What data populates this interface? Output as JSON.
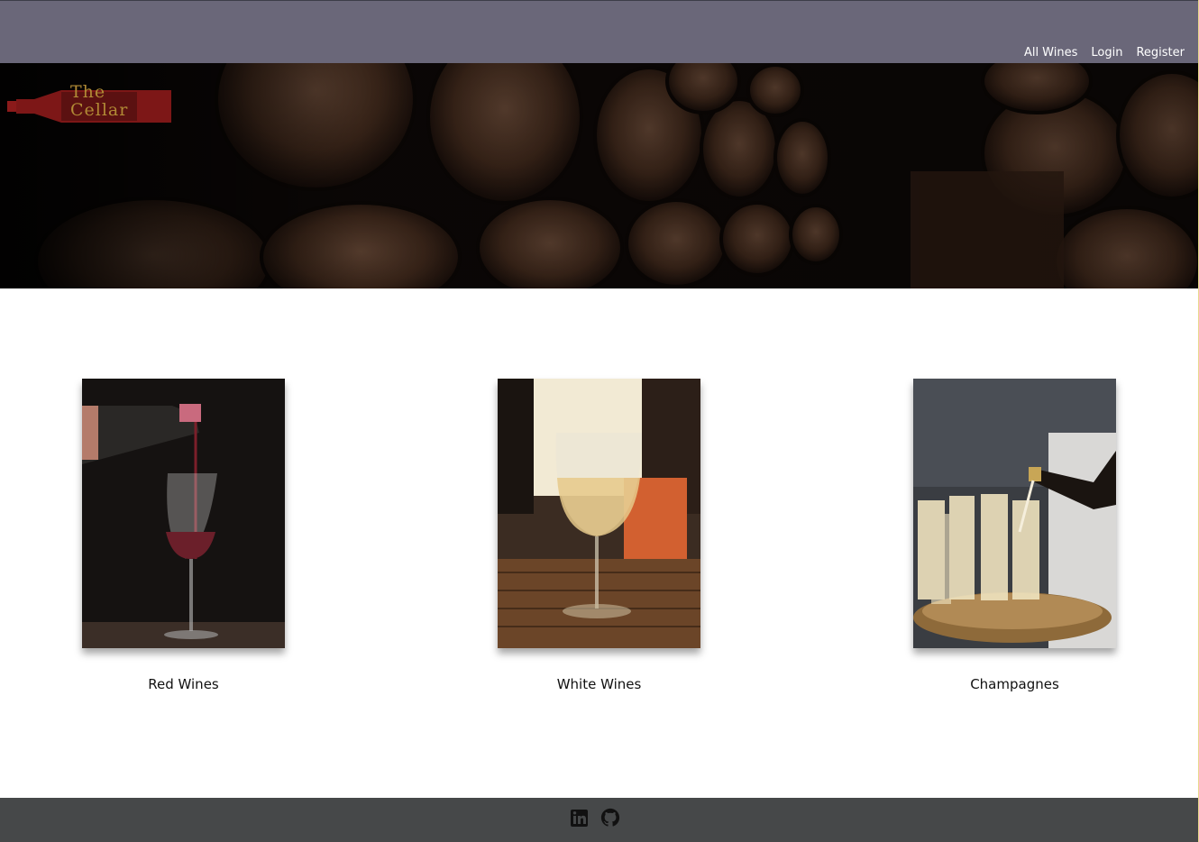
{
  "nav": {
    "links": [
      "All Wines",
      "Login",
      "Register"
    ]
  },
  "logo": {
    "line1": "The",
    "line2": "Cellar"
  },
  "categories": [
    {
      "label": "Red Wines"
    },
    {
      "label": "White Wines"
    },
    {
      "label": "Champagnes"
    }
  ],
  "footer": {
    "icons": [
      "linkedin-icon",
      "github-icon"
    ]
  },
  "colors": {
    "navbar": "#6a6779",
    "footer": "#464849",
    "logo_red": "#8b1a1a",
    "logo_gold": "#b18a35"
  }
}
